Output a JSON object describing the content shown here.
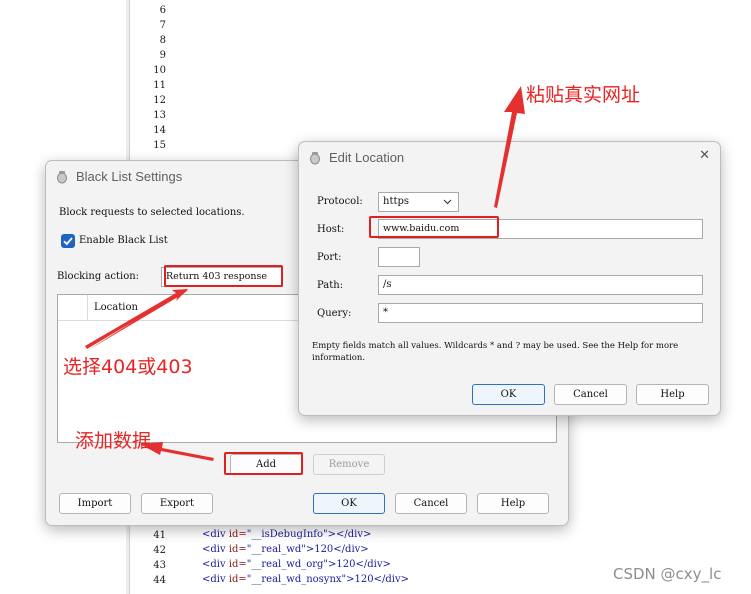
{
  "editor": {
    "top_lines": [
      "6",
      "7",
      "8",
      "9",
      "10",
      "11",
      "12",
      "13",
      "14",
      "15"
    ],
    "bottom_lines": [
      {
        "num": "41",
        "open": "<div ",
        "attr": "id=",
        "value": "\"__isDebugInfo\"",
        "rest": "></div>"
      },
      {
        "num": "42",
        "open": "<div ",
        "attr": "id=",
        "value": "\"__real_wd\"",
        "rest": ">120</div>"
      },
      {
        "num": "43",
        "open": "<div ",
        "attr": "id=",
        "value": "\"__real_wd_org\"",
        "rest": ">120</div>"
      },
      {
        "num": "44",
        "open": "<div ",
        "attr": "id=",
        "value": "\"__real_wd_nosynx\"",
        "rest": ">120</div>"
      }
    ]
  },
  "blacklist": {
    "title": "Black List Settings",
    "description": "Block requests to selected locations.",
    "enable_label": "Enable Black List",
    "enable_checked": true,
    "blocking_action_label": "Blocking action:",
    "blocking_action_value": "Return 403 response",
    "column_location": "Location",
    "add": "Add",
    "remove": "Remove",
    "import": "Import",
    "export": "Export",
    "ok": "OK",
    "cancel": "Cancel",
    "help": "Help"
  },
  "edit_location": {
    "title": "Edit Location",
    "protocol_label": "Protocol:",
    "protocol_value": "https",
    "host_label": "Host:",
    "host_value": "www.baidu.com",
    "port_label": "Port:",
    "port_value": "",
    "path_label": "Path:",
    "path_value": "/s",
    "query_label": "Query:",
    "query_value": "*",
    "hint": "Empty fields match all values. Wildcards * and ? may be used. See the Help for more information.",
    "ok": "OK",
    "cancel": "Cancel",
    "help": "Help",
    "close_glyph": "✕"
  },
  "annotations": {
    "paste_url": "粘贴真实网址",
    "select_404_403": "选择404或403",
    "add_data": "添加数据",
    "color": "#e02020"
  },
  "watermark": "CSDN @cxy_lc"
}
